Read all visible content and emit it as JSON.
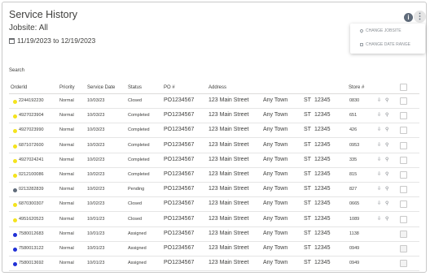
{
  "header": {
    "title": "Service History",
    "jobsite": "Jobsite: All",
    "date_range": "11/19/2023 to 12/19/2023"
  },
  "menu": {
    "change_jobsite": "CHANGE JOBSITE",
    "change_date_range": "CHANGE DATE RANGE"
  },
  "search": {
    "label": "Search"
  },
  "columns": {
    "order_id": "OrderId",
    "priority": "Priority",
    "service_date": "Service Date",
    "status": "Status",
    "po": "PO #",
    "address": "Address",
    "store": "Store #"
  },
  "colors": {
    "yellow": "#f4e31d",
    "blue": "#1f2fd6",
    "gray": "#5f6b7a"
  },
  "rows": [
    {
      "dot": "yellow",
      "order": "2244192230",
      "priority": "Normal",
      "date": "10/03/23",
      "status": "Closed",
      "po": "PO1234567",
      "street": "123 Main Street",
      "city": "Any Town",
      "state": "ST",
      "zip": "12345",
      "store": "0830",
      "actions": true,
      "disabled": false
    },
    {
      "dot": "yellow",
      "order": "4927023904",
      "priority": "Normal",
      "date": "10/03/23",
      "status": "Completed",
      "po": "PO1234567",
      "street": "123 Main Street",
      "city": "Any Town",
      "state": "ST",
      "zip": "12345",
      "store": "651",
      "actions": true,
      "disabled": false
    },
    {
      "dot": "yellow",
      "order": "4927023990",
      "priority": "Normal",
      "date": "10/03/23",
      "status": "Completed",
      "po": "PO1234567",
      "street": "123 Main Street",
      "city": "Any Town",
      "state": "ST",
      "zip": "12345",
      "store": "426",
      "actions": true,
      "disabled": false
    },
    {
      "dot": "yellow",
      "order": "6871072600",
      "priority": "Normal",
      "date": "10/03/23",
      "status": "Completed",
      "po": "PO1234567",
      "street": "123 Main Street",
      "city": "Any Town",
      "state": "ST",
      "zip": "12345",
      "store": "0953",
      "actions": true,
      "disabled": false
    },
    {
      "dot": "yellow",
      "order": "4927024241",
      "priority": "Normal",
      "date": "10/02/23",
      "status": "Completed",
      "po": "PO1234567",
      "street": "123 Main Street",
      "city": "Any Town",
      "state": "ST",
      "zip": "12345",
      "store": "335",
      "actions": true,
      "disabled": false
    },
    {
      "dot": "yellow",
      "order": "0212100086",
      "priority": "Normal",
      "date": "10/02/23",
      "status": "Completed",
      "po": "PO1234567",
      "street": "123 Main Street",
      "city": "Any Town",
      "state": "ST",
      "zip": "12345",
      "store": "815",
      "actions": true,
      "disabled": false
    },
    {
      "dot": "gray",
      "order": "0213282839",
      "priority": "Normal",
      "date": "10/02/23",
      "status": "Pending",
      "po": "PO1234567",
      "street": "123 Main Street",
      "city": "Any Town",
      "state": "ST",
      "zip": "12345",
      "store": "827",
      "actions": true,
      "disabled": false
    },
    {
      "dot": "yellow",
      "order": "6870300307",
      "priority": "Normal",
      "date": "10/02/23",
      "status": "Closed",
      "po": "PO1234567",
      "street": "123 Main Street",
      "city": "Any Town",
      "state": "ST",
      "zip": "12345",
      "store": "0665",
      "actions": true,
      "disabled": false
    },
    {
      "dot": "yellow",
      "order": "4951620523",
      "priority": "Normal",
      "date": "10/01/23",
      "status": "Closed",
      "po": "PO1234567",
      "street": "123 Main Street",
      "city": "Any Town",
      "state": "ST",
      "zip": "12345",
      "store": "1089",
      "actions": true,
      "disabled": false
    },
    {
      "dot": "blue",
      "order": "7580012683",
      "priority": "Normal",
      "date": "10/01/23",
      "status": "Assigned",
      "po": "PO1234567",
      "street": "123 Main Street",
      "city": "Any Town",
      "state": "ST",
      "zip": "12345",
      "store": "1138",
      "actions": false,
      "disabled": true
    },
    {
      "dot": "blue",
      "order": "7580013122",
      "priority": "Normal",
      "date": "10/01/23",
      "status": "Assigned",
      "po": "PO1234567",
      "street": "123 Main Street",
      "city": "Any Town",
      "state": "ST",
      "zip": "12345",
      "store": "0949",
      "actions": false,
      "disabled": true
    },
    {
      "dot": "blue",
      "order": "7580013692",
      "priority": "Normal",
      "date": "10/01/23",
      "status": "Assigned",
      "po": "PO1234567",
      "street": "123 Main Street",
      "city": "Any Town",
      "state": "ST",
      "zip": "12345",
      "store": "0949",
      "actions": false,
      "disabled": true
    }
  ]
}
